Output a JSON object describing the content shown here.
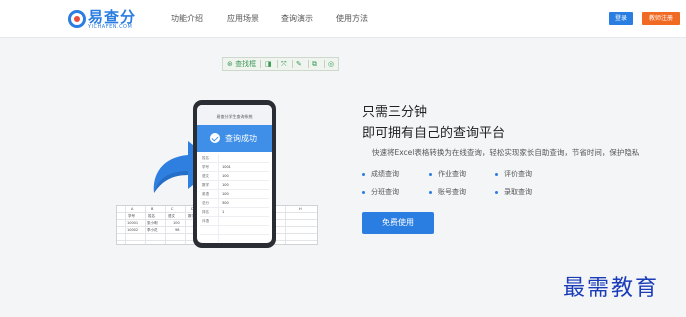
{
  "header": {
    "logo_text": "易查分",
    "logo_sub": "YICHAFEN.COM",
    "nav": [
      "功能介绍",
      "应用场景",
      "查询演示",
      "使用方法"
    ],
    "login_label": "登录",
    "register_label": "教师注册"
  },
  "toolbar": {
    "items": [
      "查找框",
      "",
      "",
      "",
      "",
      ""
    ]
  },
  "phone": {
    "topbar_title": "易查分学生查询系统",
    "banner_text": "查询成功",
    "rows": [
      {
        "k": "姓名",
        "v": ""
      },
      {
        "k": "学号",
        "v": "1001"
      },
      {
        "k": "语文",
        "v": "100"
      },
      {
        "k": "数学",
        "v": "100"
      },
      {
        "k": "英语",
        "v": "100"
      },
      {
        "k": "总分",
        "v": "300"
      },
      {
        "k": "排名",
        "v": "1"
      },
      {
        "k": "评语",
        "v": ""
      },
      {
        "k": "",
        "v": ""
      },
      {
        "k": "",
        "v": ""
      }
    ]
  },
  "spreadsheet": {
    "headers": [
      "A",
      "B",
      "C",
      "D",
      "E",
      "F",
      "G",
      "H"
    ],
    "row1": [
      "学号",
      "姓名",
      "语文",
      "数学",
      "英语",
      "总分",
      "老师评语"
    ],
    "row2": [
      "10001",
      "张小明",
      "100",
      "100",
      "100",
      "300",
      "继续加油!"
    ],
    "row3": [
      "10002",
      "李小花",
      "98",
      "100",
      "100",
      "298",
      "再接再厉"
    ]
  },
  "hero": {
    "title_line1": "只需三分钟",
    "title_line2": "即可拥有自己的查询平台",
    "description": "快速将Excel表格转换为在线查询，轻松实现家长自助查询，节省时间，保护隐私",
    "features": [
      "成绩查询",
      "作业查询",
      "评价查询",
      "分班查询",
      "账号查询",
      "录取查询"
    ],
    "cta_label": "免费使用"
  },
  "watermark": "最需教育",
  "colors": {
    "brand_blue": "#2a7de1",
    "register_orange": "#f06a24"
  }
}
